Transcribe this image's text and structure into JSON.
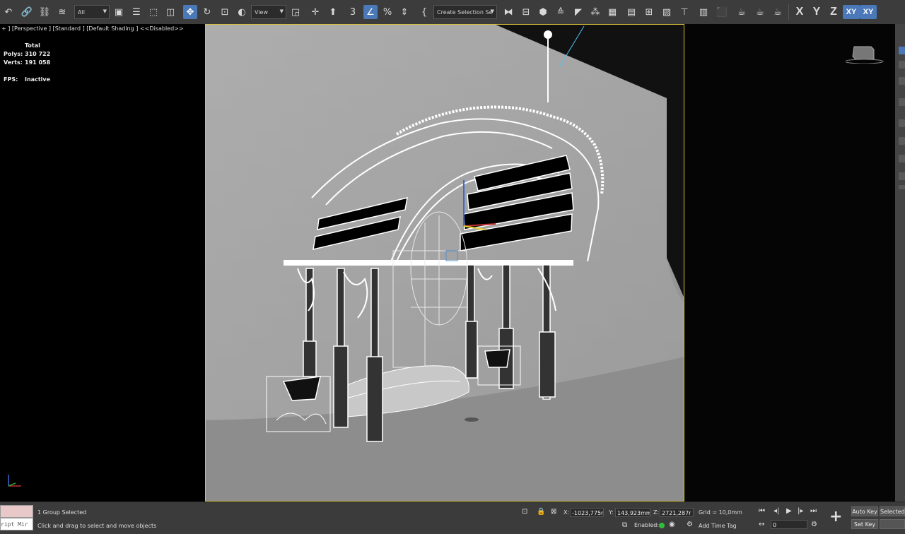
{
  "toolbar": {
    "filter_dropdown": "All",
    "refcoord_dropdown": "View",
    "selection_set_dropdown": "Create Selection Se",
    "axes": [
      "X",
      "Y",
      "Z",
      "XY",
      "XY"
    ]
  },
  "viewport_left": {
    "label": "+ ] [Perspective ] [Standard ] [Default Shading ]",
    "disabled": "<<Disabled>>",
    "stats": {
      "total_label": "Total",
      "polys_label": "Polys:",
      "polys_value": "310 722",
      "verts_label": "Verts:",
      "verts_value": "191 058",
      "fps_label": "FPS:",
      "fps_value": "Inactive"
    }
  },
  "status": {
    "maxscript": "ript Mir",
    "selection_info": "1 Group Selected",
    "prompt": "Click and drag to select and move objects",
    "x_label": "X:",
    "x_value": "-1023,775r",
    "y_label": "Y:",
    "y_value": "143,923mm",
    "z_label": "Z:",
    "z_value": "2721,287r",
    "grid": "Grid = 10,0mm",
    "enabled_label": "Enabled:",
    "add_time_tag": "Add Time Tag",
    "frame_value": "0",
    "auto_key": "Auto Key",
    "set_key": "Set Key",
    "selected": "Selected"
  },
  "colors": {
    "viewport_border": "#d7c23a",
    "accent_blue": "#4a78b8",
    "ui_gray": "#3c3c3c"
  }
}
